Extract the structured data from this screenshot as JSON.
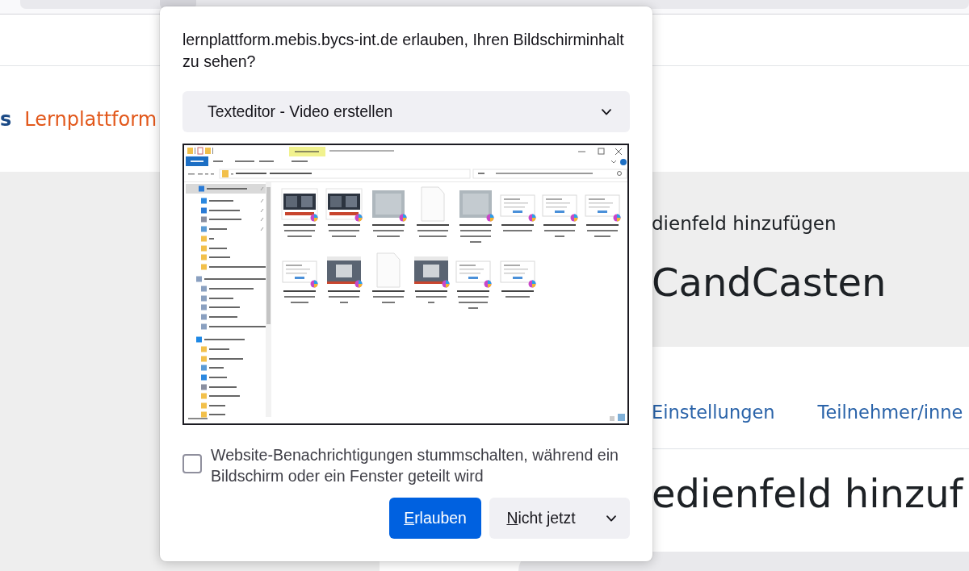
{
  "page": {
    "logo_fragment": "s",
    "site_name": "Lernplattform",
    "breadcrumb": "dienfeld hinzufügen",
    "course_title": "CandCasten",
    "nav_tabs": [
      {
        "label": "Einstellungen",
        "selected": false
      },
      {
        "label": "Teilnehmer/inne",
        "selected": false
      }
    ],
    "heading": "edienfeld hinzuf"
  },
  "dialog": {
    "message": "lernplattform.mebis.bycs-int.de erlauben, Ihren Bildschirminhalt zu sehen?",
    "source_select": {
      "value": "Texteditor - Video erstellen"
    },
    "mute_checkbox": {
      "label": "Website-Benachrichtigungen stummschalten, während ein Bildschirm oder ein Fenster geteilt wird",
      "checked": false
    },
    "buttons": [
      {
        "kind": "primary",
        "label": "Erlauben",
        "access_key_underlined": true
      },
      {
        "kind": "split",
        "label": "Nicht jetzt",
        "access_key_underlined": true
      }
    ]
  }
}
